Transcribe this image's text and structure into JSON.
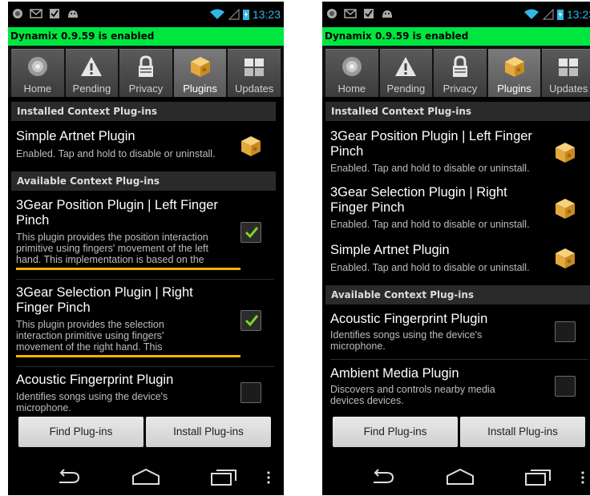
{
  "status": {
    "time": "13:23"
  },
  "notification": "Dynamix 0.9.59 is enabled",
  "tabs": [
    "Home",
    "Pending",
    "Privacy",
    "Plugins",
    "Updates"
  ],
  "buttons": {
    "find": "Find Plug-ins",
    "install": "Install Plug-ins"
  },
  "left": {
    "installed_header": "Installed Context Plug-ins",
    "installed": [
      {
        "title": "Simple Artnet Plugin",
        "desc": "Enabled. Tap and hold to disable or uninstall."
      }
    ],
    "available_header": "Available Context Plug-ins",
    "available": [
      {
        "title_1": "3Gear Position Plugin | Left Finger",
        "title_2": "Pinch",
        "desc_1": "This plugin provides the position interaction",
        "desc_2": "primitive using fingers' movement of the left",
        "desc_3": "hand. This implementation is based on the",
        "checked": true
      },
      {
        "title_1": "3Gear Selection Plugin | Right",
        "title_2": "Finger Pinch",
        "desc_1": "This plugin provides the selection",
        "desc_2": "interaction primitive using fingers'",
        "desc_3": "movement of the right hand. This",
        "checked": true
      },
      {
        "title_1": "Acoustic Fingerprint Plugin",
        "desc_1": "Identifies songs using the device's",
        "desc_2": "microphone.",
        "checked": false
      }
    ]
  },
  "right": {
    "installed_header": "Installed Context Plug-ins",
    "installed": [
      {
        "title_1": "3Gear Position Plugin | Left Finger",
        "title_2": "Pinch",
        "desc": "Enabled. Tap and hold to disable or uninstall."
      },
      {
        "title_1": "3Gear Selection Plugin | Right",
        "title_2": "Finger Pinch",
        "desc": "Enabled. Tap and hold to disable or uninstall."
      },
      {
        "title_1": "Simple Artnet Plugin",
        "desc": "Enabled. Tap and hold to disable or uninstall."
      }
    ],
    "available_header": "Available Context Plug-ins",
    "available": [
      {
        "title_1": "Acoustic Fingerprint Plugin",
        "desc_1": "Identifies songs using the device's",
        "desc_2": "microphone.",
        "checked": false
      },
      {
        "title_1": "Ambient Media Plugin",
        "desc_1": "Discovers and controls nearby media",
        "desc_2": "devices devices.",
        "checked": false
      }
    ]
  },
  "colors": {
    "notification_bg": "#00e641",
    "clock": "#33b5e5",
    "checkmark": "#7ed321",
    "highlight_underline": "#f2b400"
  }
}
